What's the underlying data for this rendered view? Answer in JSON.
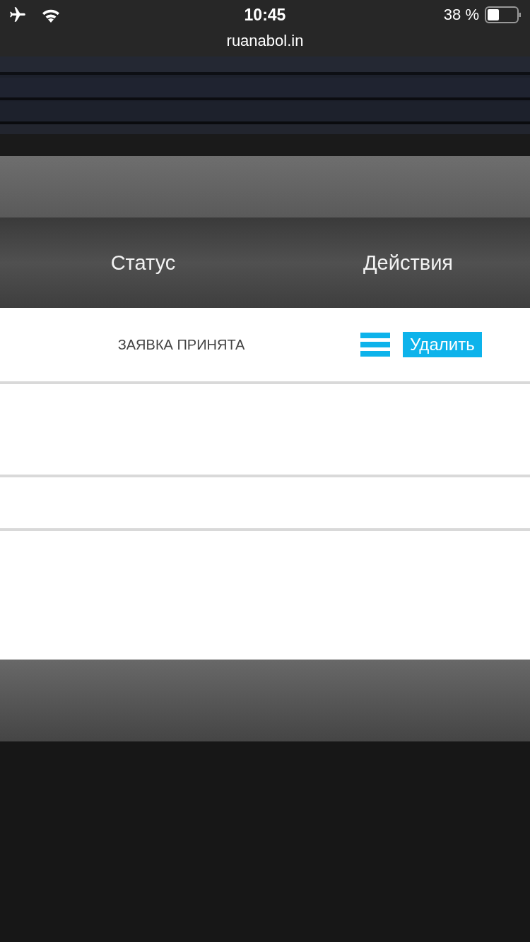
{
  "status_bar": {
    "time": "10:45",
    "url": "ruanabol.in",
    "battery": "38 %"
  },
  "table": {
    "columns": [
      "Статус",
      "Действия"
    ],
    "rows": [
      {
        "status": "ЗАЯВКА ПРИНЯТА",
        "action": "Удалить"
      }
    ]
  }
}
